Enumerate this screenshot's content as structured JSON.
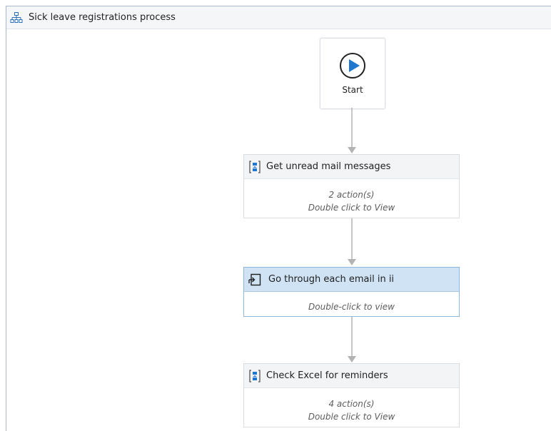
{
  "window": {
    "title": "Sick leave registrations process",
    "title_icon": "flow-diagram-icon"
  },
  "flow": {
    "start": {
      "label": "Start",
      "icon": "play-icon"
    },
    "steps": [
      {
        "title": "Get unread mail messages",
        "icon": "subflow-icon",
        "line1": "2 action(s)",
        "line2": "Double click to View",
        "selected": false
      },
      {
        "title": "Go through each email in ii",
        "icon": "loop-icon",
        "line1": "Double-click to view",
        "selected": true
      },
      {
        "title": "Check Excel for reminders",
        "icon": "subflow-icon",
        "line1": "4 action(s)",
        "line2": "Double click to View",
        "selected": false
      }
    ]
  },
  "colors": {
    "accent": "#1f77d0",
    "selected_header": "#cfe3f4",
    "connector": "#b3b3b3"
  }
}
